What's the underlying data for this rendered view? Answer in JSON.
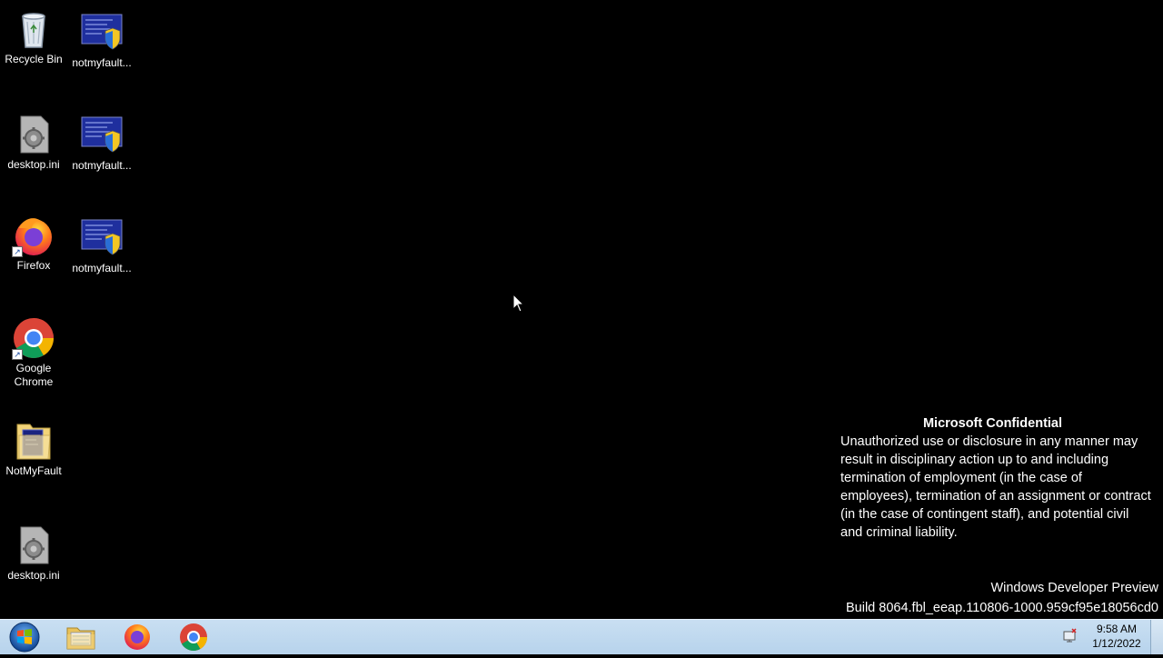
{
  "desktop": {
    "icons": [
      {
        "label": "Recycle Bin",
        "icon": "recycle-bin-icon"
      },
      {
        "label": "notmyfault...",
        "icon": "app-shield-icon"
      },
      {
        "label": "desktop.ini",
        "icon": "config-file-icon"
      },
      {
        "label": "notmyfault...",
        "icon": "app-shield-icon"
      },
      {
        "label": "Firefox",
        "icon": "firefox-icon"
      },
      {
        "label": "notmyfault...",
        "icon": "app-shield-icon"
      },
      {
        "label": "Google Chrome",
        "icon": "chrome-icon"
      },
      {
        "label": "NotMyFault",
        "icon": "folder-icon"
      },
      {
        "label": "desktop.ini",
        "icon": "config-file-icon"
      }
    ]
  },
  "watermark": {
    "title": "Microsoft Confidential",
    "body": "Unauthorized use or disclosure in any manner may result in disciplinary action up to and including termination of employment (in the case of employees), termination of an assignment or contract (in the case of contingent staff), and potential civil and criminal liability."
  },
  "build": {
    "line1": "Windows Developer Preview",
    "line2": "Build 8064.fbl_eeap.110806-1000.959cf95e18056cd0"
  },
  "taskbar": {
    "apps": [
      "file-explorer-icon",
      "firefox-icon",
      "chrome-icon"
    ],
    "clock": {
      "time": "9:58 AM",
      "date": "1/12/2022"
    }
  },
  "colors": {
    "desktop_bg": "#000000",
    "taskbar_bg": "#bfd8ef"
  }
}
